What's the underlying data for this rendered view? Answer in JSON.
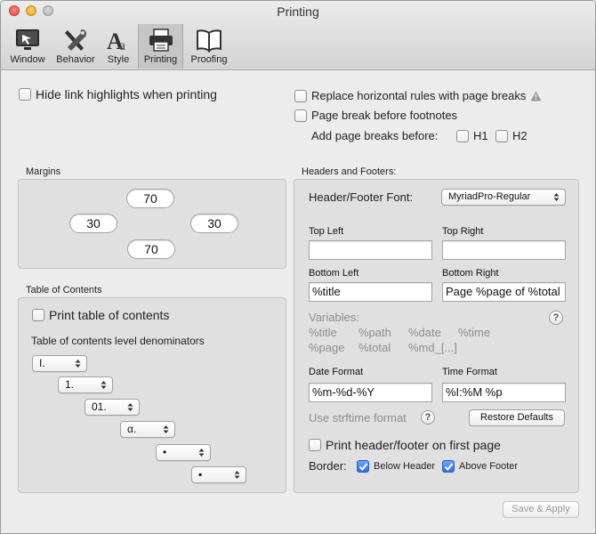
{
  "window": {
    "title": "Printing"
  },
  "toolbar": [
    {
      "label": "Window",
      "icon": "window-icon"
    },
    {
      "label": "Behavior",
      "icon": "tools-icon"
    },
    {
      "label": "Style",
      "icon": "style-font-icon"
    },
    {
      "label": "Printing",
      "icon": "printer-icon",
      "selected": true
    },
    {
      "label": "Proofing",
      "icon": "book-icon"
    }
  ],
  "options": {
    "hide_links": {
      "label": "Hide link highlights when printing",
      "checked": false
    },
    "replace_hr": {
      "label": "Replace horizontal rules with page breaks",
      "checked": false
    },
    "page_break_footnotes": {
      "label": "Page break before footnotes",
      "checked": false
    },
    "add_breaks_label": "Add page breaks before:",
    "h1": {
      "label": "H1",
      "checked": false
    },
    "h2": {
      "label": "H2",
      "checked": false
    }
  },
  "margins": {
    "label": "Margins",
    "top": "70",
    "left": "30",
    "right": "30",
    "bottom": "70"
  },
  "toc": {
    "label": "Table of Contents",
    "print": {
      "label": "Print table of contents",
      "checked": false
    },
    "denominators_label": "Table of contents level denominators",
    "levels": [
      "I.",
      "1.",
      "01.",
      "α.",
      "•",
      "▪"
    ]
  },
  "headers_footers": {
    "label": "Headers and Footers:",
    "font_label": "Header/Footer Font:",
    "font_value": "MyriadPro-Regular",
    "top_left": {
      "label": "Top Left",
      "value": ""
    },
    "top_right": {
      "label": "Top Right",
      "value": ""
    },
    "bottom_left": {
      "label": "Bottom Left",
      "value": "%title"
    },
    "bottom_right": {
      "label": "Bottom Right",
      "value": "Page %page of %total"
    },
    "variables_label": "Variables:",
    "variables_row1": [
      "%title",
      "%path",
      "%date",
      "%time"
    ],
    "variables_row2": [
      "%page",
      "%total",
      "%md_[...]"
    ],
    "date_format": {
      "label": "Date Format",
      "value": "%m-%d-%Y"
    },
    "time_format": {
      "label": "Time Format",
      "value": "%I:%M %p"
    },
    "strftime_label": "Use strftime format",
    "restore_label": "Restore Defaults",
    "print_first_page": {
      "label": "Print header/footer on first page",
      "checked": false
    },
    "border_label": "Border:",
    "below_header": {
      "label": "Below Header",
      "checked": true
    },
    "above_footer": {
      "label": "Above Footer",
      "checked": true
    }
  },
  "footer": {
    "save_label": "Save & Apply"
  },
  "colors": {
    "accent": "#2d6fe0",
    "muted_text": "#8e8e8e",
    "panel": "#e0e0e0"
  }
}
